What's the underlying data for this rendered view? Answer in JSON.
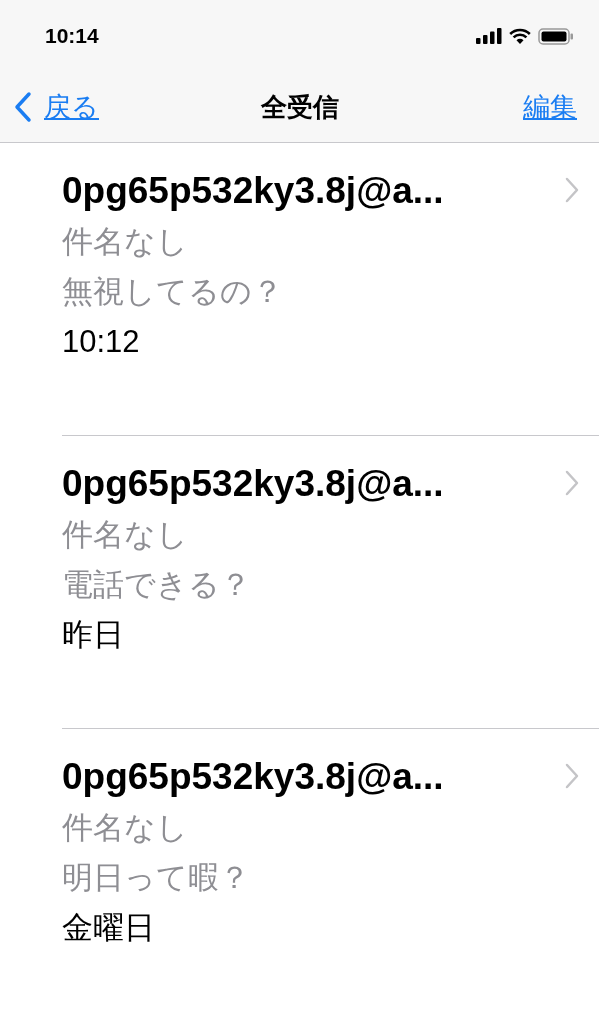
{
  "status_bar": {
    "time": "10:14"
  },
  "nav": {
    "back": "戻る",
    "title": "全受信",
    "edit": "編集"
  },
  "messages": [
    {
      "sender": "0pg65p532ky3.8j@a...",
      "subject": "件名なし",
      "preview": "無視してるの？",
      "date": "10:12"
    },
    {
      "sender": "0pg65p532ky3.8j@a...",
      "subject": "件名なし",
      "preview": "電話できる？",
      "date": "昨日"
    },
    {
      "sender": "0pg65p532ky3.8j@a...",
      "subject": "件名なし",
      "preview": "明日って暇？",
      "date": "金曜日"
    }
  ]
}
